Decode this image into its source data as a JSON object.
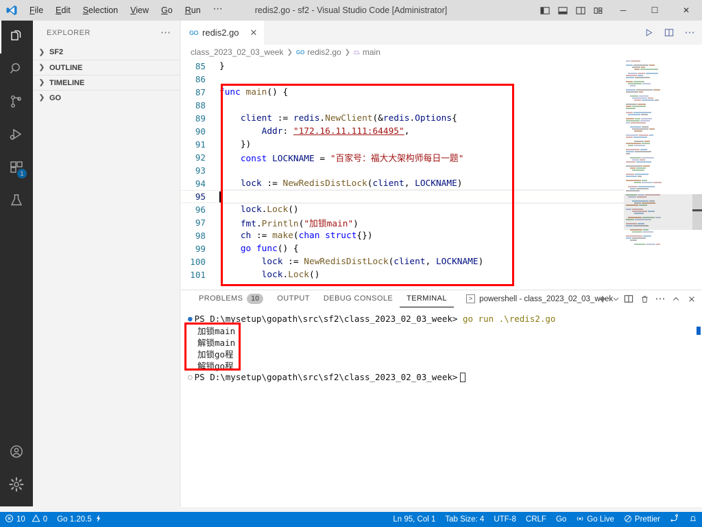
{
  "titlebar": {
    "logo_icon": "vscode-logo-icon",
    "menus": [
      "File",
      "Edit",
      "Selection",
      "View",
      "Go",
      "Run",
      "⋯"
    ],
    "window_title": "redis2.go - sf2 - Visual Studio Code [Administrator]",
    "layout_buttons": [
      {
        "name": "toggle-primary-sidebar",
        "icon": "panel-left-icon"
      },
      {
        "name": "toggle-panel",
        "icon": "panel-bottom-icon"
      },
      {
        "name": "toggle-secondary-sidebar",
        "icon": "panel-right-icon"
      },
      {
        "name": "customize-layout",
        "icon": "layout-grid-icon"
      }
    ],
    "window_controls": {
      "minimize": "─",
      "maximize": "☐",
      "close": "✕"
    }
  },
  "activitybar": {
    "items": [
      {
        "name": "explorer",
        "icon": "files-icon",
        "active": true,
        "badge": null
      },
      {
        "name": "search",
        "icon": "search-icon",
        "active": false,
        "badge": null
      },
      {
        "name": "source-control",
        "icon": "source-control-icon",
        "active": false,
        "badge": null
      },
      {
        "name": "run-and-debug",
        "icon": "run-debug-icon",
        "active": false,
        "badge": null
      },
      {
        "name": "extensions",
        "icon": "extensions-icon",
        "active": false,
        "badge": "1"
      },
      {
        "name": "testing",
        "icon": "beaker-icon",
        "active": false,
        "badge": null
      }
    ],
    "bottom": [
      {
        "name": "accounts",
        "icon": "account-icon"
      },
      {
        "name": "manage",
        "icon": "gear-icon"
      }
    ]
  },
  "sidebar": {
    "title": "EXPLORER",
    "more_actions_icon": "ellipsis-icon",
    "sections": [
      {
        "label": "SF2",
        "expanded": false
      },
      {
        "label": "OUTLINE",
        "expanded": false
      },
      {
        "label": "TIMELINE",
        "expanded": false
      },
      {
        "label": "GO",
        "expanded": false
      }
    ]
  },
  "editor": {
    "tabs": [
      {
        "label": "redis2.go",
        "icon": "go-file-icon",
        "active": true,
        "close_icon": "close-icon"
      }
    ],
    "tab_actions": [
      {
        "name": "run-go-file-button",
        "icon": "play-icon"
      },
      {
        "name": "split-editor-right-button",
        "icon": "split-editor-icon"
      },
      {
        "name": "more-editor-actions-button",
        "icon": "ellipsis-icon"
      }
    ],
    "breadcrumbs": [
      {
        "label": "class_2023_02_03_week",
        "icon": null
      },
      {
        "label": "redis2.go",
        "icon": "go-file-icon"
      },
      {
        "label": "main",
        "icon": "symbol-namespace-icon"
      }
    ],
    "first_line_number": 85,
    "lines": [
      {
        "n": 85,
        "text": "}"
      },
      {
        "n": 86,
        "text": ""
      },
      {
        "n": 87,
        "text": "func main() {"
      },
      {
        "n": 88,
        "text": ""
      },
      {
        "n": 89,
        "text": "    client := redis.NewClient(&redis.Options{"
      },
      {
        "n": 90,
        "text": "        Addr: \"172.16.11.111:64495\","
      },
      {
        "n": 91,
        "text": "    })"
      },
      {
        "n": 92,
        "text": "    const LOCKNAME = \"百家号：福大大架构师每日一题\""
      },
      {
        "n": 93,
        "text": ""
      },
      {
        "n": 94,
        "text": "    lock := NewRedisDistLock(client, LOCKNAME)"
      },
      {
        "n": 95,
        "text": "",
        "current": true
      },
      {
        "n": 96,
        "text": "    lock.Lock()"
      },
      {
        "n": 97,
        "text": "    fmt.Println(\"加锁main\")"
      },
      {
        "n": 98,
        "text": "    ch := make(chan struct{})"
      },
      {
        "n": 99,
        "text": "    go func() {"
      },
      {
        "n": 100,
        "text": "        lock := NewRedisDistLock(client, LOCKNAME)"
      },
      {
        "n": 101,
        "text": "        lock.Lock()"
      }
    ],
    "cursor_line": 95,
    "annotation_box_color": "#ff0000"
  },
  "panel": {
    "tabs": [
      {
        "label": "PROBLEMS",
        "badge": "10",
        "active": false
      },
      {
        "label": "OUTPUT",
        "badge": null,
        "active": false
      },
      {
        "label": "DEBUG CONSOLE",
        "badge": null,
        "active": false
      },
      {
        "label": "TERMINAL",
        "badge": null,
        "active": true
      }
    ],
    "terminal_selector": {
      "icon": "terminal-powershell-icon",
      "label": "powershell - class_2023_02_03_week"
    },
    "actions": [
      {
        "name": "new-terminal-button",
        "icon": "plus-icon"
      },
      {
        "name": "terminal-profile-dropdown",
        "icon": "chevron-down-icon"
      },
      {
        "name": "split-terminal-button",
        "icon": "split-icon"
      },
      {
        "name": "kill-terminal-button",
        "icon": "trash-icon"
      },
      {
        "name": "terminal-more-actions-button",
        "icon": "ellipsis-icon"
      },
      {
        "name": "maximize-panel-button",
        "icon": "chevron-up-icon"
      },
      {
        "name": "close-panel-button",
        "icon": "close-icon"
      }
    ],
    "terminal": {
      "prompt1_path": "PS D:\\mysetup\\gopath\\src\\sf2\\class_2023_02_03_week>",
      "prompt1_command": "go run .\\redis2.go",
      "output": [
        "加锁main",
        "解锁main",
        "加锁go程",
        "解锁go程"
      ],
      "prompt2_path": "PS D:\\mysetup\\gopath\\src\\sf2\\class_2023_02_03_week>",
      "annotation_box_color": "#ff0000"
    }
  },
  "statusbar": {
    "background": "#0078d4",
    "left": [
      {
        "name": "problems-errors",
        "icon": "error-circle-icon",
        "label": "10"
      },
      {
        "name": "problems-warnings",
        "icon": "warning-triangle-icon",
        "label": "0"
      },
      {
        "name": "go-version",
        "icon": "go-lightning-icon",
        "label": "Go 1.20.5"
      }
    ],
    "right": [
      {
        "name": "editor-position",
        "label": "Ln 95, Col 1"
      },
      {
        "name": "editor-indentation",
        "label": "Tab Size: 4"
      },
      {
        "name": "editor-encoding",
        "label": "UTF-8"
      },
      {
        "name": "editor-eol",
        "label": "CRLF"
      },
      {
        "name": "editor-language",
        "label": "Go"
      },
      {
        "name": "go-live",
        "icon": "broadcast-icon",
        "label": "Go Live"
      },
      {
        "name": "prettier",
        "icon": "prettier-check-icon",
        "label": "Prettier"
      },
      {
        "name": "remote-tunnel",
        "icon": "remote-tunnel-icon",
        "label": ""
      },
      {
        "name": "notifications",
        "icon": "bell-icon",
        "label": ""
      }
    ]
  }
}
